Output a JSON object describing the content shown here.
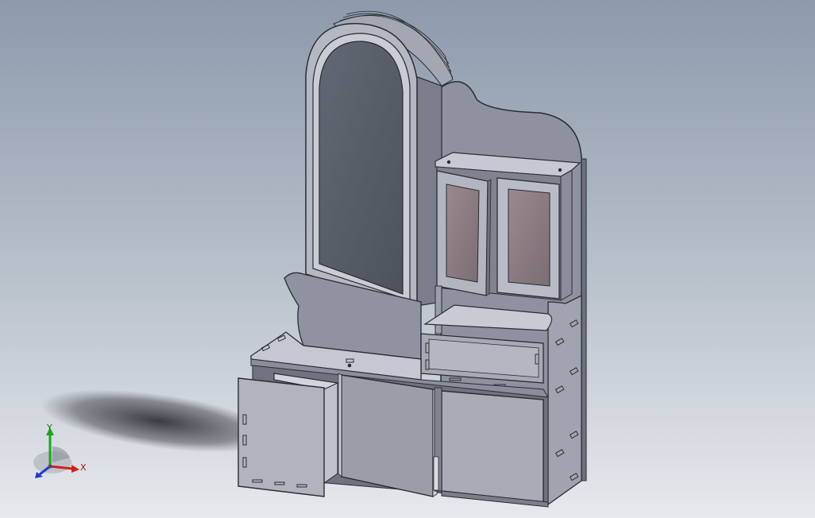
{
  "viewport": {
    "colors": {
      "background_top": "#8d9aac",
      "background_bottom": "#e6e9ed",
      "panel_face": "#aeb1bd",
      "panel_side": "#8a8e9c",
      "panel_dark": "#6d717e",
      "edge": "#2a2c32",
      "mirror_glass": "#575c66",
      "cabinet_glass": "#8a7c82",
      "door_face": "#9ea2ab",
      "light_face": "#c6c9d3"
    }
  },
  "triad": {
    "x_label": "X",
    "y_label": "Y",
    "z_label": "",
    "x_color": "#d21e1e",
    "y_color": "#1ea51e",
    "z_color": "#1e3cd2"
  },
  "model": {
    "name": "",
    "parts": [
      "arched-mirror-frame",
      "mirror-glass",
      "top-glass-cabinet",
      "left-glass-door",
      "right-glass-door",
      "vanity-countertop",
      "drawer",
      "left-door",
      "middle-door",
      "right-door",
      "open-box-drawer",
      "back-splash-panel",
      "side-panel"
    ]
  }
}
